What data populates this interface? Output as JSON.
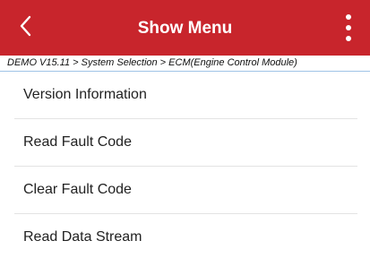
{
  "colors": {
    "header_background": "#c8252c",
    "header_text": "#ffffff",
    "breadcrumb_underline": "#9fc3e6",
    "divider": "#e3e3e3"
  },
  "header": {
    "title": "Show Menu",
    "back_icon": "chevron-left-icon",
    "more_icon": "more-vertical-icon"
  },
  "breadcrumb": {
    "text": "DEMO V15.11 > System Selection > ECM(Engine Control Module)"
  },
  "menu": {
    "items": [
      {
        "label": "Version Information"
      },
      {
        "label": "Read Fault Code"
      },
      {
        "label": "Clear Fault Code"
      },
      {
        "label": "Read Data Stream"
      }
    ]
  }
}
